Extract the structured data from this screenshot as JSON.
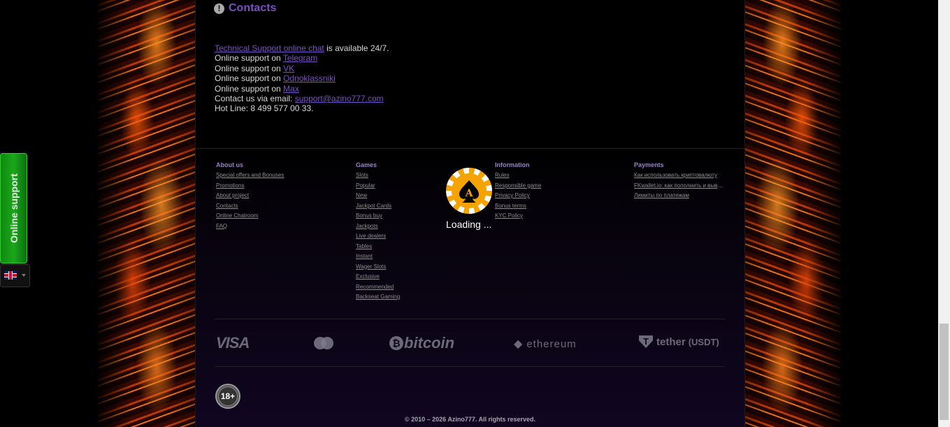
{
  "contacts": {
    "title": "Contacts",
    "chat_link": "Technical Support online chat",
    "chat_suffix": " is available 24/7.",
    "telegram_prefix": "Online support on ",
    "telegram_link": "Telegram",
    "vk_prefix": "Online support on ",
    "vk_link": "VK",
    "ok_prefix": "Online support on ",
    "ok_link": "Odnoklassniki",
    "max_prefix": "Online support on ",
    "max_link": "Max",
    "email_prefix": "Contact us via email: ",
    "email_link": "support@azino777.com",
    "hotline": "Hot Line: 8 499 577 00 33."
  },
  "footer": {
    "about": {
      "title": "About us",
      "items": [
        "Special offers and Bonuses",
        "Promotions",
        "About project",
        "Contacts",
        "Online Chatroom",
        "FAQ"
      ]
    },
    "games": {
      "title": "Games",
      "items": [
        "Slots",
        "Popular",
        "New",
        "Jackpot Cards",
        "Bonus buy",
        "Jackpots",
        "Live dealers",
        "Tables",
        "Instant",
        "Wager Slots",
        "Exclusive",
        "Recommended",
        "Backseat Gaming"
      ]
    },
    "information": {
      "title": "Information",
      "items": [
        "Rules",
        "Responsible game",
        "Privacy Policy",
        "Bonus terms",
        "KYC Policy"
      ]
    },
    "payments": {
      "title": "Payments",
      "items": [
        "Как использовать криптовалюту",
        "FKwallet.io: как пополнить и вывести",
        "Лимиты по платежам"
      ]
    }
  },
  "loader": {
    "text": "Loading ..."
  },
  "payments_logos": {
    "visa": "VISA",
    "bitcoin": "bitcoin",
    "ethereum": "ethereum",
    "tether": "tether",
    "tether_suffix": "(USDT)"
  },
  "age_badge": "18+",
  "copyright": "© 2010 – 2026 Azino777. All rights reserved.",
  "online_support_label": "Online support",
  "colors": {
    "accent": "#7b50c2",
    "support_green": "#1aa71b",
    "chip_gold": "#f5a300"
  }
}
